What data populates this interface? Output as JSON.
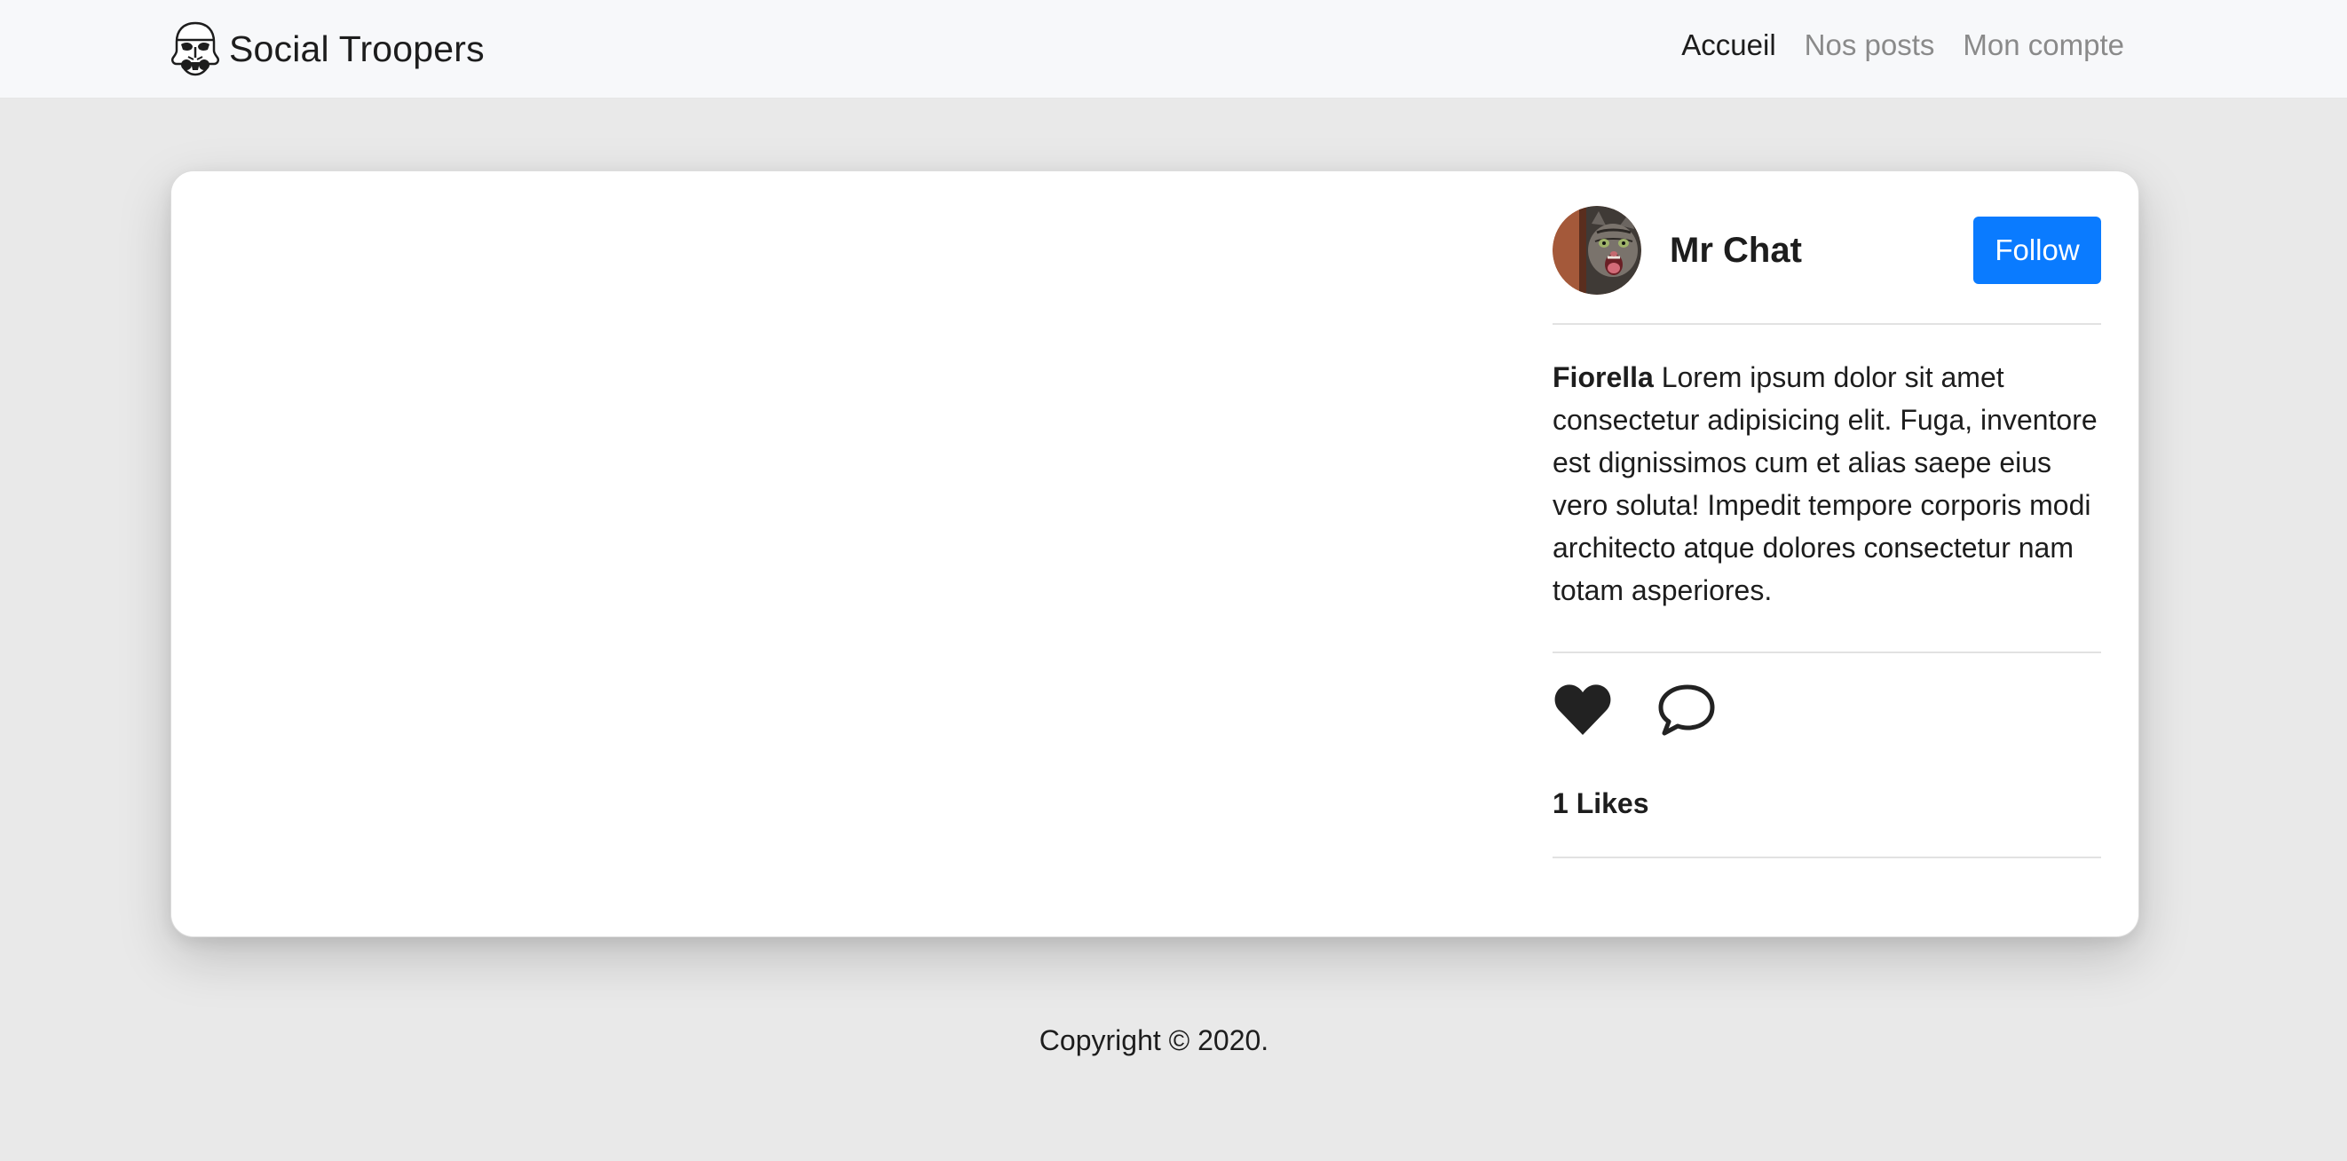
{
  "navbar": {
    "brand_name": "Social Troopers",
    "logo_icon": "stormtrooper-helmet-icon",
    "links": [
      {
        "label": "Accueil",
        "active": true
      },
      {
        "label": "Nos posts",
        "active": false
      },
      {
        "label": "Mon compte",
        "active": false
      }
    ]
  },
  "post": {
    "author_name": "Mr Chat",
    "avatar_icon": "cat-avatar",
    "follow_label": "Follow",
    "caption_author": "Fiorella",
    "caption_text": "Lorem ipsum dolor sit amet consectetur adipisicing elit. Fuga, inventore est dignissimos cum et alias saepe eius vero soluta! Impedit tempore corporis modi architecto atque dolores consectetur nam totam asperiores.",
    "like_icon": "heart-icon",
    "comment_icon": "speech-bubble-icon",
    "likes_label": "1 Likes"
  },
  "footer": {
    "copyright": "Copyright © 2020."
  },
  "colors": {
    "accent": "#0a7bff",
    "page_background": "#e9e9e9",
    "navbar_background": "#f7f8fa"
  }
}
